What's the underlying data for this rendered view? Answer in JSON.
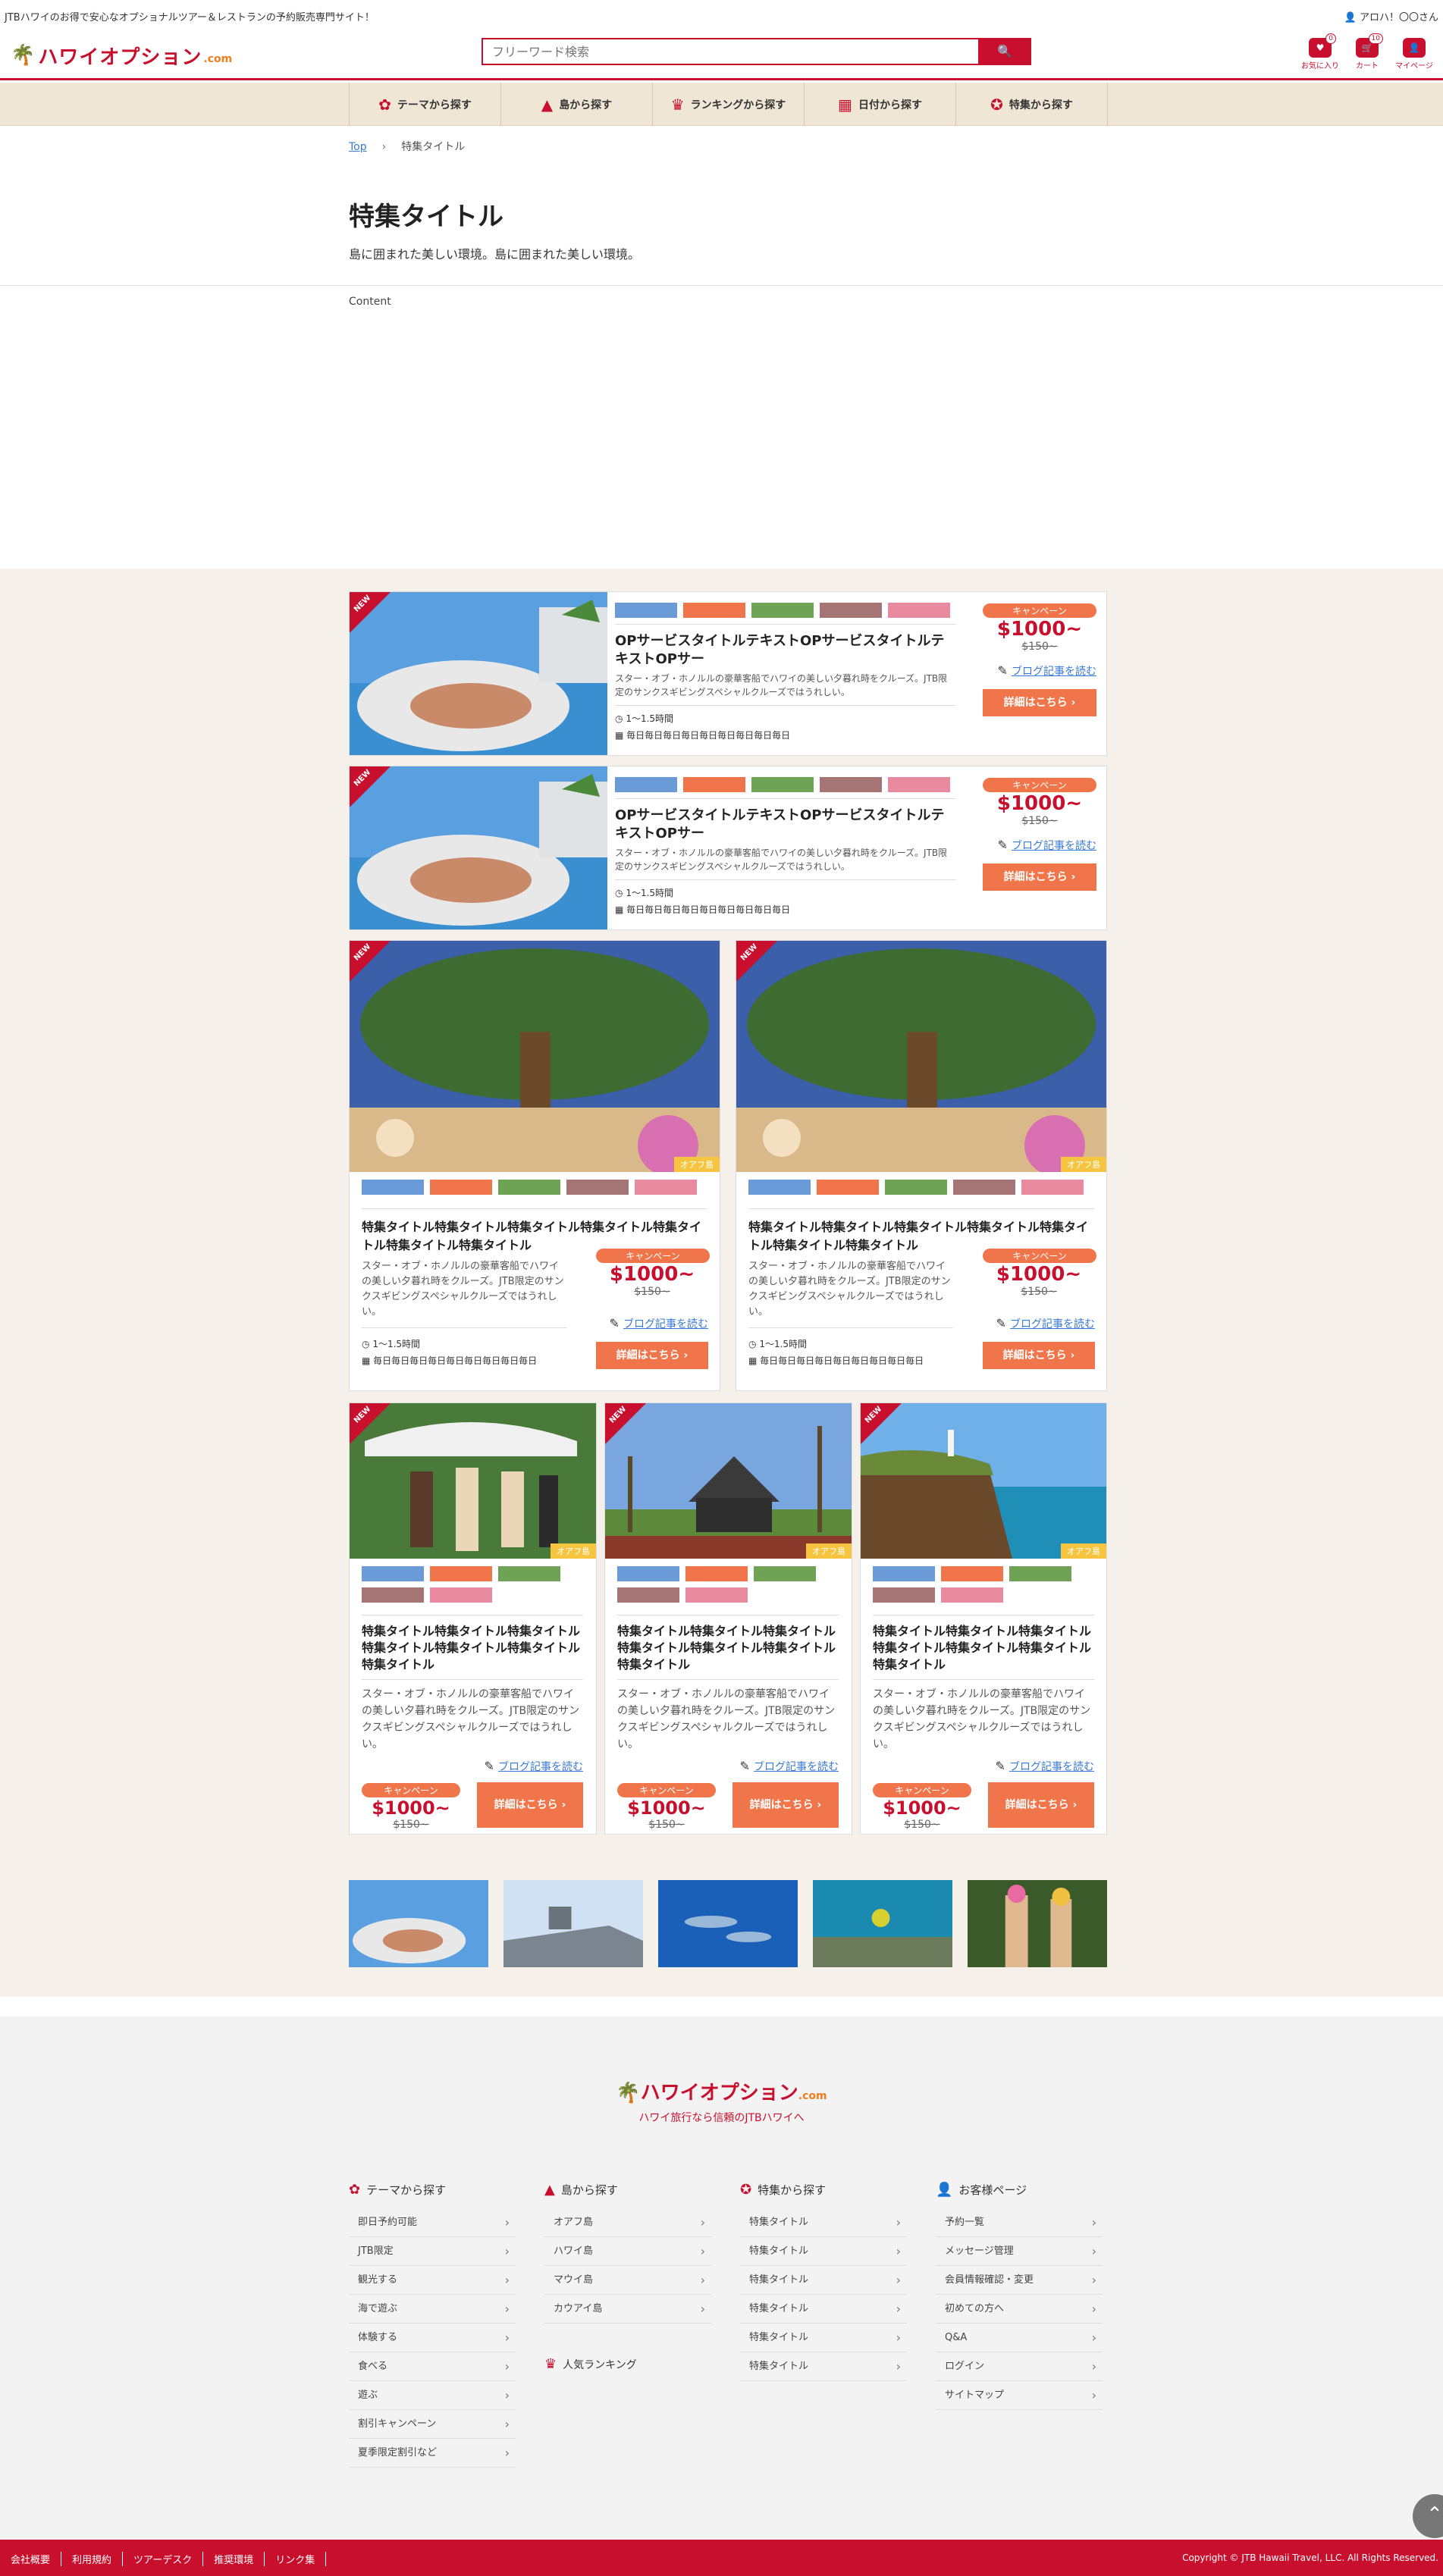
{
  "topbar": {
    "message": "JTBハワイのお得で安心なオプショナルツアー＆レストランの予約販売専門サイト！",
    "user": "アロハ！〇〇さん"
  },
  "header": {
    "logo": "ハワイオプション",
    "logo_com": ".com",
    "search_placeholder": "フリーワード検索",
    "search_button": "検索",
    "icons": [
      {
        "name": "favorite-icon",
        "label": "お気に入り",
        "count": "0"
      },
      {
        "name": "cart-icon",
        "label": "カート",
        "count": "10"
      },
      {
        "name": "mypage-icon",
        "label": "マイページ",
        "count": ""
      }
    ]
  },
  "nav": [
    {
      "label": "テーマから探す",
      "icon": "theme-icon"
    },
    {
      "label": "島から探す",
      "icon": "island-icon"
    },
    {
      "label": "ランキングから探す",
      "icon": "crown-icon"
    },
    {
      "label": "日付から探す",
      "icon": "calendar-icon"
    },
    {
      "label": "特集から探す",
      "icon": "medal-icon"
    }
  ],
  "breadcrumb": {
    "home": "Top",
    "current": "特集タイトル"
  },
  "page": {
    "title": "特集タイトル",
    "description": "島に囲まれた美しい環境。島に囲まれた美しい環境。",
    "content": "Content"
  },
  "colors": {
    "brand": "#c8102e",
    "accent": "#f0754a",
    "beige": "#f5f0ea",
    "tag_colors": [
      "#6a9ad8",
      "#f0754a",
      "#6ea355",
      "#a57575",
      "#e98aa0"
    ]
  },
  "badge_new": "NEW",
  "island_badge": "オアフ島",
  "campaign": "キャンペーン",
  "price": "$1000~",
  "old_price": "$150~",
  "blog_link": "ブログ記事を読む",
  "detail_button": "詳細はこちら",
  "duration": "1～1.5時間",
  "days": "毎日毎日毎日毎日毎日毎日毎日毎日毎日",
  "wide_cards": [
    {
      "title": "OPサービスタイトルテキストOPサービスタイトルテキストOPサー",
      "description": "スター・オブ・ホノルルの豪華客船でハワイの美しい夕暮れ時をクルーズ。JTB限定のサンクスギビングスペシャルクルーズではうれしい。"
    },
    {
      "title": "OPサービスタイトルテキストOPサービスタイトルテキストOPサー",
      "description": "スター・オブ・ホノルルの豪華客船でハワイの美しい夕暮れ時をクルーズ。JTB限定のサンクスギビングスペシャルクルーズではうれしい。"
    }
  ],
  "half_cards": [
    {
      "title": "特集タイトル特集タイトル特集タイトル特集タイトル特集タイトル特集タイトル特集タイトル",
      "description": "スター・オブ・ホノルルの豪華客船でハワイの美しい夕暮れ時をクルーズ。JTB限定のサンクスギビングスペシャルクルーズではうれしい。"
    },
    {
      "title": "特集タイトル特集タイトル特集タイトル特集タイトル特集タイトル特集タイトル特集タイトル",
      "description": "スター・オブ・ホノルルの豪華客船でハワイの美しい夕暮れ時をクルーズ。JTB限定のサンクスギビングスペシャルクルーズではうれしい。"
    }
  ],
  "third_cards": [
    {
      "title": "特集タイトル特集タイトル特集タイトル特集タイトル特集タイトル特集タイトル特集タイトル",
      "description": "スター・オブ・ホノルルの豪華客船でハワイの美しい夕暮れ時をクルーズ。JTB限定のサンクスギビングスペシャルクルーズではうれしい。"
    },
    {
      "title": "特集タイトル特集タイトル特集タイトル特集タイトル特集タイトル特集タイトル特集タイトル",
      "description": "スター・オブ・ホノルルの豪華客船でハワイの美しい夕暮れ時をクルーズ。JTB限定のサンクスギビングスペシャルクルーズではうれしい。"
    },
    {
      "title": "特集タイトル特集タイトル特集タイトル特集タイトル特集タイトル特集タイトル特集タイトル",
      "description": "スター・オブ・ホノルルの豪華客船でハワイの美しい夕暮れ時をクルーズ。JTB限定のサンクスギビングスペシャルクルーズではうれしい。"
    }
  ],
  "footer": {
    "logo": "ハワイオプション",
    "logo_com": ".com",
    "tagline": "ハワイ旅行なら信頼のJTBハワイへ",
    "columns": [
      {
        "heading": "テーマから探す",
        "icon": "theme-icon",
        "items": [
          "即日予約可能",
          "JTB限定",
          "観光する",
          "海で遊ぶ",
          "体験する",
          "食べる",
          "遊ぶ",
          "割引キャンペーン",
          "夏季限定割引など"
        ]
      },
      {
        "heading": "島から探す",
        "icon": "island-icon",
        "items": [
          "オアフ島",
          "ハワイ島",
          "マウイ島",
          "カウアイ島"
        ]
      },
      {
        "heading": "特集から探す",
        "icon": "medal-icon",
        "items": [
          "特集タイトル",
          "特集タイトル",
          "特集タイトル",
          "特集タイトル",
          "特集タイトル",
          "特集タイトル"
        ]
      },
      {
        "heading": "お客様ページ",
        "icon": "user-icon",
        "items": [
          "予約一覧",
          "メッセージ管理",
          "会員情報確認・変更",
          "初めての方へ",
          "Q&A",
          "ログイン",
          "サイトマップ"
        ]
      }
    ],
    "ranking": "人気ランキング",
    "bottom_links": [
      "会社概要",
      "利用規約",
      "ツアーデスク",
      "推奨環境",
      "リンク集"
    ],
    "copyright": "Copyright © JTB Hawaii Travel, LLC. All Rights Reserved."
  }
}
